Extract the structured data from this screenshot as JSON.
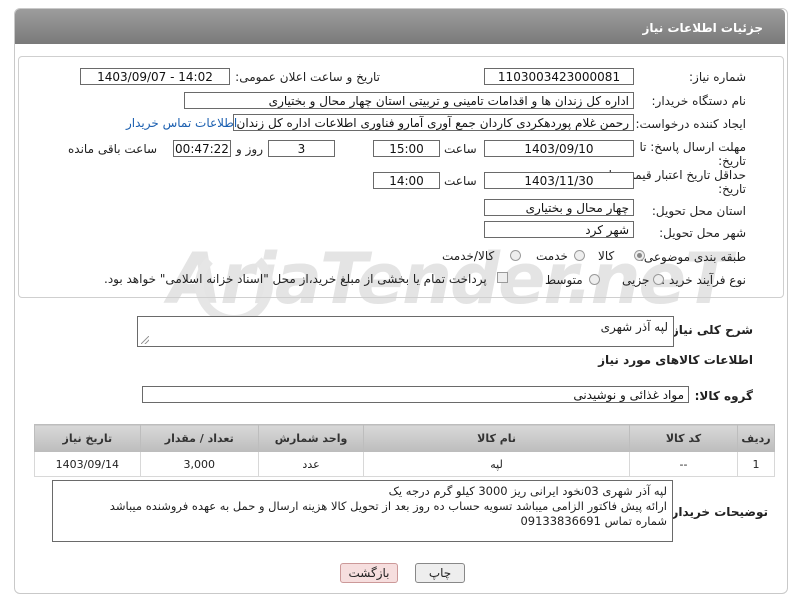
{
  "header": {
    "title": "جزئیات اطلاعات نیاز"
  },
  "watermark": "AriaTender.neT",
  "form": {
    "need_number_label": "شماره نیاز:",
    "need_number": "1103003423000081",
    "announce_label": "تاریخ و ساعت اعلان عمومی:",
    "announce_value": "1403/09/07 - 14:02",
    "buyer_label": "نام دستگاه خریدار:",
    "buyer_value": "اداره کل زندان ها و اقدامات تامینی و تربیتی استان چهار محال و بختیاری",
    "creator_label": "ایجاد کننده درخواست:",
    "creator_value": "رحمن غلام پوردهکردی کاردان جمع آوری آمارو فناوری اطلاعات اداره کل زندان ها",
    "contact_link": "اطلاعات تماس خریدار",
    "deadline_label_1": "مهلت ارسال پاسخ: تا",
    "deadline_label_2": "تاریخ:",
    "deadline_date": "1403/09/10",
    "time_label": "ساعت",
    "deadline_time": "15:00",
    "days_value": "3",
    "days_label": "روز و",
    "remaining_value": "00:47:22",
    "remaining_label": "ساعت باقی مانده",
    "validity_label_1": "حداقل تاریخ اعتبار قیمت: تا",
    "validity_label_2": "تاریخ:",
    "validity_date": "1403/11/30",
    "validity_time_label": "ساعت",
    "validity_time": "14:00",
    "province_label": "استان محل تحویل:",
    "province_value": "چهار محال و بختیاری",
    "city_label": "شهر محل تحویل:",
    "city_value": "شهر کرد",
    "category_label": "طبقه بندی موضوعی:",
    "category_options": [
      "کالا",
      "خدمت",
      "کالا/خدمت"
    ],
    "category_selected": "کالا",
    "process_label": "نوع فرآیند خرید :",
    "process_options": [
      "جزیی",
      "متوسط"
    ],
    "payment_note": "پرداخت تمام یا بخشی از مبلغ خرید،از محل \"اسناد خزانه اسلامی\" خواهد بود."
  },
  "summary": {
    "label": "شرح کلی نیاز:",
    "value": "لپه آذر شهری"
  },
  "goods_section": {
    "title": "اطلاعات کالاهای مورد نیاز"
  },
  "goods_group": {
    "label": "گروه کالا:",
    "value": "مواد غذائی و نوشیدنی"
  },
  "table": {
    "headers": [
      "ردیف",
      "کد کالا",
      "نام کالا",
      "واحد شمارش",
      "تعداد / مقدار",
      "تاریخ نیاز"
    ],
    "rows": [
      {
        "row": "1",
        "code": "--",
        "name": "لپه",
        "unit": "عدد",
        "qty": "3,000",
        "date": "1403/09/14"
      }
    ]
  },
  "buyer_notes": {
    "label": "توضیحات خریدار:",
    "lines": [
      "لپه آذر شهری 03نخود ایرانی ریز 3000 کیلو گرم درجه یک",
      "ارائه پیش فاکتور الزامی میباشد تسویه حساب ده روز بعد از تحویل کالا هزینه ارسال و حمل به عهده فروشنده میباشد",
      "شماره تماس  09133836691"
    ]
  },
  "buttons": {
    "print": "چاپ",
    "back": "بازگشت"
  },
  "colors": {
    "header": "#8a8a8a",
    "link": "#1b5fb0",
    "back_button": "#f6dede",
    "print_button": "#eeeeee"
  }
}
